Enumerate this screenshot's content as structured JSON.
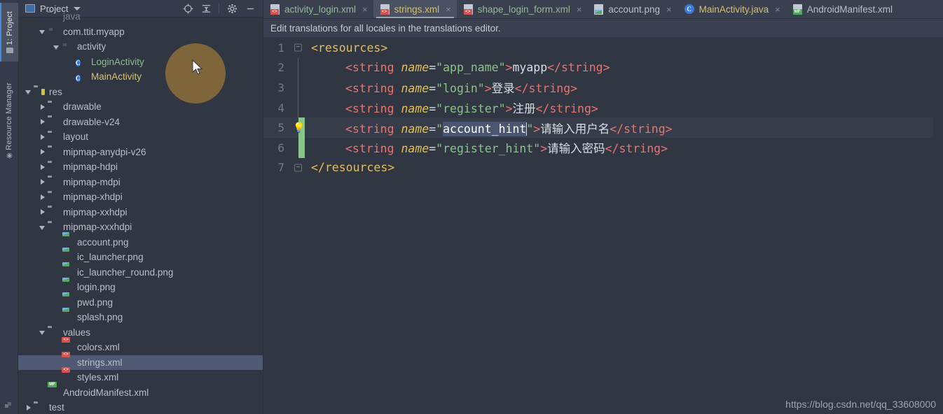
{
  "toolstrip": {
    "tabs": [
      {
        "label": "1: Project",
        "icon": "project-folder-icon",
        "active": true
      },
      {
        "label": "Resource Manager",
        "icon": "resource-manager-icon",
        "active": false
      }
    ],
    "bottom_icon": "build-variants-icon"
  },
  "project_panel": {
    "title": "Project",
    "title_icon": "project-view-icon",
    "dropdown_icon": "chevron-down-icon",
    "tools": [
      {
        "name": "locate-icon",
        "glyph": "⊕"
      },
      {
        "name": "collapse-all-icon",
        "glyph": "≡"
      },
      {
        "name": "settings-gear-icon",
        "glyph": "⚙"
      },
      {
        "name": "hide-panel-icon",
        "glyph": "−"
      }
    ],
    "tree": [
      {
        "label": "java",
        "indent": 2,
        "arrow": "none",
        "icon": "folder",
        "color": "plain",
        "partial": true
      },
      {
        "label": "com.ttit.myapp",
        "indent": 2,
        "arrow": "open",
        "icon": "package",
        "color": "plain"
      },
      {
        "label": "activity",
        "indent": 3,
        "arrow": "open",
        "icon": "package",
        "color": "plain"
      },
      {
        "label": "LoginActivity",
        "indent": 4,
        "arrow": "none",
        "icon": "class",
        "color": "green"
      },
      {
        "label": "MainActivity",
        "indent": 4,
        "arrow": "none",
        "icon": "class",
        "color": "yellow"
      },
      {
        "label": "res",
        "indent": 1,
        "arrow": "open",
        "icon": "folder-res",
        "color": "plain"
      },
      {
        "label": "drawable",
        "indent": 2,
        "arrow": "closed",
        "icon": "folder",
        "color": "plain"
      },
      {
        "label": "drawable-v24",
        "indent": 2,
        "arrow": "closed",
        "icon": "folder",
        "color": "plain"
      },
      {
        "label": "layout",
        "indent": 2,
        "arrow": "closed",
        "icon": "folder",
        "color": "plain"
      },
      {
        "label": "mipmap-anydpi-v26",
        "indent": 2,
        "arrow": "closed",
        "icon": "folder",
        "color": "plain"
      },
      {
        "label": "mipmap-hdpi",
        "indent": 2,
        "arrow": "closed",
        "icon": "folder",
        "color": "plain"
      },
      {
        "label": "mipmap-mdpi",
        "indent": 2,
        "arrow": "closed",
        "icon": "folder",
        "color": "plain"
      },
      {
        "label": "mipmap-xhdpi",
        "indent": 2,
        "arrow": "closed",
        "icon": "folder",
        "color": "plain"
      },
      {
        "label": "mipmap-xxhdpi",
        "indent": 2,
        "arrow": "closed",
        "icon": "folder",
        "color": "plain"
      },
      {
        "label": "mipmap-xxxhdpi",
        "indent": 2,
        "arrow": "open",
        "icon": "folder",
        "color": "plain"
      },
      {
        "label": "account.png",
        "indent": 3,
        "arrow": "none",
        "icon": "png",
        "color": "plain"
      },
      {
        "label": "ic_launcher.png",
        "indent": 3,
        "arrow": "none",
        "icon": "png",
        "color": "plain"
      },
      {
        "label": "ic_launcher_round.png",
        "indent": 3,
        "arrow": "none",
        "icon": "png",
        "color": "plain"
      },
      {
        "label": "login.png",
        "indent": 3,
        "arrow": "none",
        "icon": "png",
        "color": "plain"
      },
      {
        "label": "pwd.png",
        "indent": 3,
        "arrow": "none",
        "icon": "png",
        "color": "plain"
      },
      {
        "label": "splash.png",
        "indent": 3,
        "arrow": "none",
        "icon": "png",
        "color": "plain"
      },
      {
        "label": "values",
        "indent": 2,
        "arrow": "open",
        "icon": "folder",
        "color": "plain"
      },
      {
        "label": "colors.xml",
        "indent": 3,
        "arrow": "none",
        "icon": "xml",
        "color": "plain"
      },
      {
        "label": "strings.xml",
        "indent": 3,
        "arrow": "none",
        "icon": "xml",
        "color": "plain",
        "selected": true
      },
      {
        "label": "styles.xml",
        "indent": 3,
        "arrow": "none",
        "icon": "xml",
        "color": "plain"
      },
      {
        "label": "AndroidManifest.xml",
        "indent": 2,
        "arrow": "none",
        "icon": "manifest",
        "color": "plain"
      },
      {
        "label": "test",
        "indent": 1,
        "arrow": "closed",
        "icon": "folder",
        "color": "plain",
        "partial": true
      }
    ],
    "click_highlight": {
      "visible": true,
      "color": "#d69830"
    },
    "cursor": {
      "visible": true
    }
  },
  "editor": {
    "tabs": [
      {
        "label": "activity_login.xml",
        "icon": "xml-file-icon",
        "color": "green",
        "active": false,
        "closable": true
      },
      {
        "label": "strings.xml",
        "icon": "xml-file-icon",
        "color": "yellow",
        "active": true,
        "closable": true
      },
      {
        "label": "shape_login_form.xml",
        "icon": "xml-file-icon",
        "color": "green",
        "active": false,
        "closable": true
      },
      {
        "label": "account.png",
        "icon": "png-file-icon",
        "color": "plain",
        "active": false,
        "closable": true
      },
      {
        "label": "MainActivity.java",
        "icon": "java-class-icon",
        "color": "yellow",
        "active": false,
        "closable": true
      },
      {
        "label": "AndroidManifest.xml",
        "icon": "manifest-file-icon",
        "color": "plain",
        "active": false,
        "closable": false
      }
    ],
    "notice": "Edit translations for all locales in the translations editor.",
    "lines": [
      {
        "num": "1",
        "marker": "fold-open",
        "indent": 0,
        "tokens": [
          {
            "t": "tag-root",
            "s": "<resources>"
          }
        ]
      },
      {
        "num": "2",
        "marker": "fold-line",
        "indent": 1,
        "tokens": [
          {
            "t": "tag",
            "s": "<string "
          },
          {
            "t": "attr",
            "s": "name"
          },
          {
            "t": "eq",
            "s": "="
          },
          {
            "t": "val",
            "s": "\"app_name\""
          },
          {
            "t": "tag",
            "s": ">"
          },
          {
            "t": "txt",
            "s": "myapp"
          },
          {
            "t": "tag",
            "s": "</string>"
          }
        ]
      },
      {
        "num": "3",
        "marker": "fold-line",
        "indent": 1,
        "tokens": [
          {
            "t": "tag",
            "s": "<string "
          },
          {
            "t": "attr",
            "s": "name"
          },
          {
            "t": "eq",
            "s": "="
          },
          {
            "t": "val",
            "s": "\"login\""
          },
          {
            "t": "tag",
            "s": ">"
          },
          {
            "t": "txt",
            "s": "登录"
          },
          {
            "t": "tag",
            "s": "</string>"
          }
        ]
      },
      {
        "num": "4",
        "marker": "fold-line",
        "indent": 1,
        "tokens": [
          {
            "t": "tag",
            "s": "<string "
          },
          {
            "t": "attr",
            "s": "name"
          },
          {
            "t": "eq",
            "s": "="
          },
          {
            "t": "val",
            "s": "\"register\""
          },
          {
            "t": "tag",
            "s": ">"
          },
          {
            "t": "txt",
            "s": "注册"
          },
          {
            "t": "tag",
            "s": "</string>"
          }
        ]
      },
      {
        "num": "5",
        "marker": "bulb",
        "changed": true,
        "current": true,
        "indent": 1,
        "tokens": [
          {
            "t": "tag",
            "s": "<string "
          },
          {
            "t": "attr",
            "s": "name"
          },
          {
            "t": "eq",
            "s": "="
          },
          {
            "t": "val",
            "s": "\""
          },
          {
            "t": "sel",
            "s": "account_hint"
          },
          {
            "t": "caret",
            "s": ""
          },
          {
            "t": "val",
            "s": "\""
          },
          {
            "t": "tag",
            "s": ">"
          },
          {
            "t": "txt",
            "s": "请输入用户名"
          },
          {
            "t": "tag",
            "s": "</string>"
          }
        ]
      },
      {
        "num": "6",
        "marker": "fold-line",
        "changed": true,
        "indent": 1,
        "tokens": [
          {
            "t": "tag",
            "s": "<string "
          },
          {
            "t": "attr",
            "s": "name"
          },
          {
            "t": "eq",
            "s": "="
          },
          {
            "t": "val",
            "s": "\"register_hint\""
          },
          {
            "t": "tag",
            "s": ">"
          },
          {
            "t": "txt",
            "s": "请输入密码"
          },
          {
            "t": "tag",
            "s": "</string>"
          }
        ]
      },
      {
        "num": "7",
        "marker": "fold-close",
        "indent": 0,
        "tokens": [
          {
            "t": "tag-root",
            "s": "</resources>"
          }
        ]
      }
    ],
    "selected_token": "account_hint"
  },
  "watermark": "https://blog.csdn.net/qq_33608000"
}
